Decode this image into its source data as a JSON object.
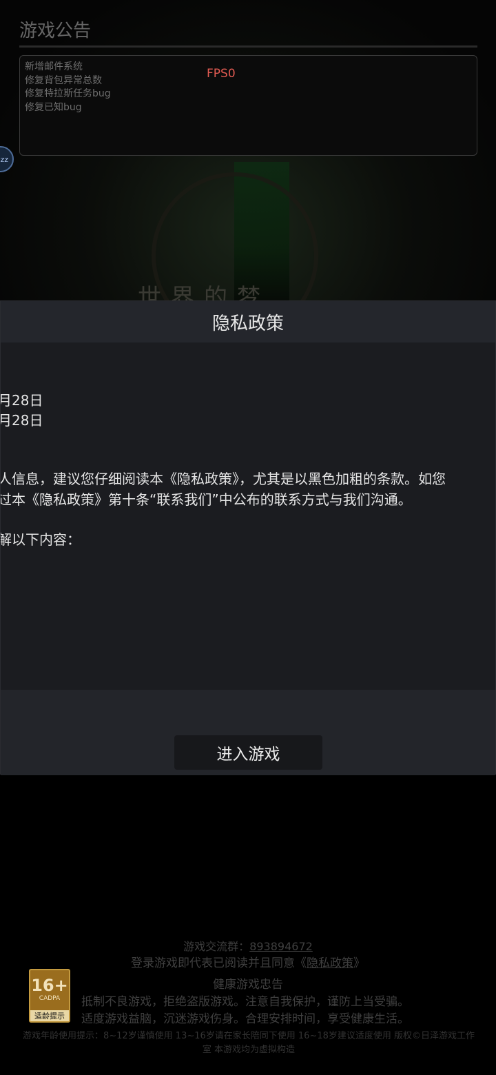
{
  "announcement": {
    "title": "游戏公告",
    "items": [
      "新增邮件系统",
      "修复背包异常总数",
      "修复特拉斯任务bug",
      "修复已知bug"
    ],
    "fps": "FPS0",
    "float_button_label": "zz"
  },
  "background": {
    "world_title": "世界的梦"
  },
  "privacy_dialog": {
    "title": "隐私政策",
    "lines": [
      "月28日",
      "月28日",
      "人信息，建议您仔细阅读本《隐私政策》，尤其是以黑色加粗的条款。如您",
      "过本《隐私政策》第十条“联系我们”中公布的联系方式与我们沟通。",
      "解以下内容："
    ],
    "enter_button": "进入游戏"
  },
  "footer": {
    "qq_group_label": "游戏交流群：",
    "qq_group_number": "893894672",
    "login_agree_prefix": "登录游戏即代表已阅读并且同意《",
    "login_agree_link": "隐私政策",
    "login_agree_suffix": "》",
    "health_title": "健康游戏忠告",
    "health_line1": "抵制不良游戏，拒绝盗版游戏。注意自我保护，谨防上当受骗。",
    "health_line2": "适度游戏益脑，沉迷游戏伤身。合理安排时间，享受健康生活。",
    "age_rating": "16+",
    "age_org": "CADPA",
    "age_tip": "适龄提示",
    "fine_print": "游戏年龄使用提示：8~12岁谨慎使用 13~16岁请在家长陪同下使用 16~18岁建议适度使用 版权©日泽游戏工作室 本游戏均为虚拟构造"
  }
}
